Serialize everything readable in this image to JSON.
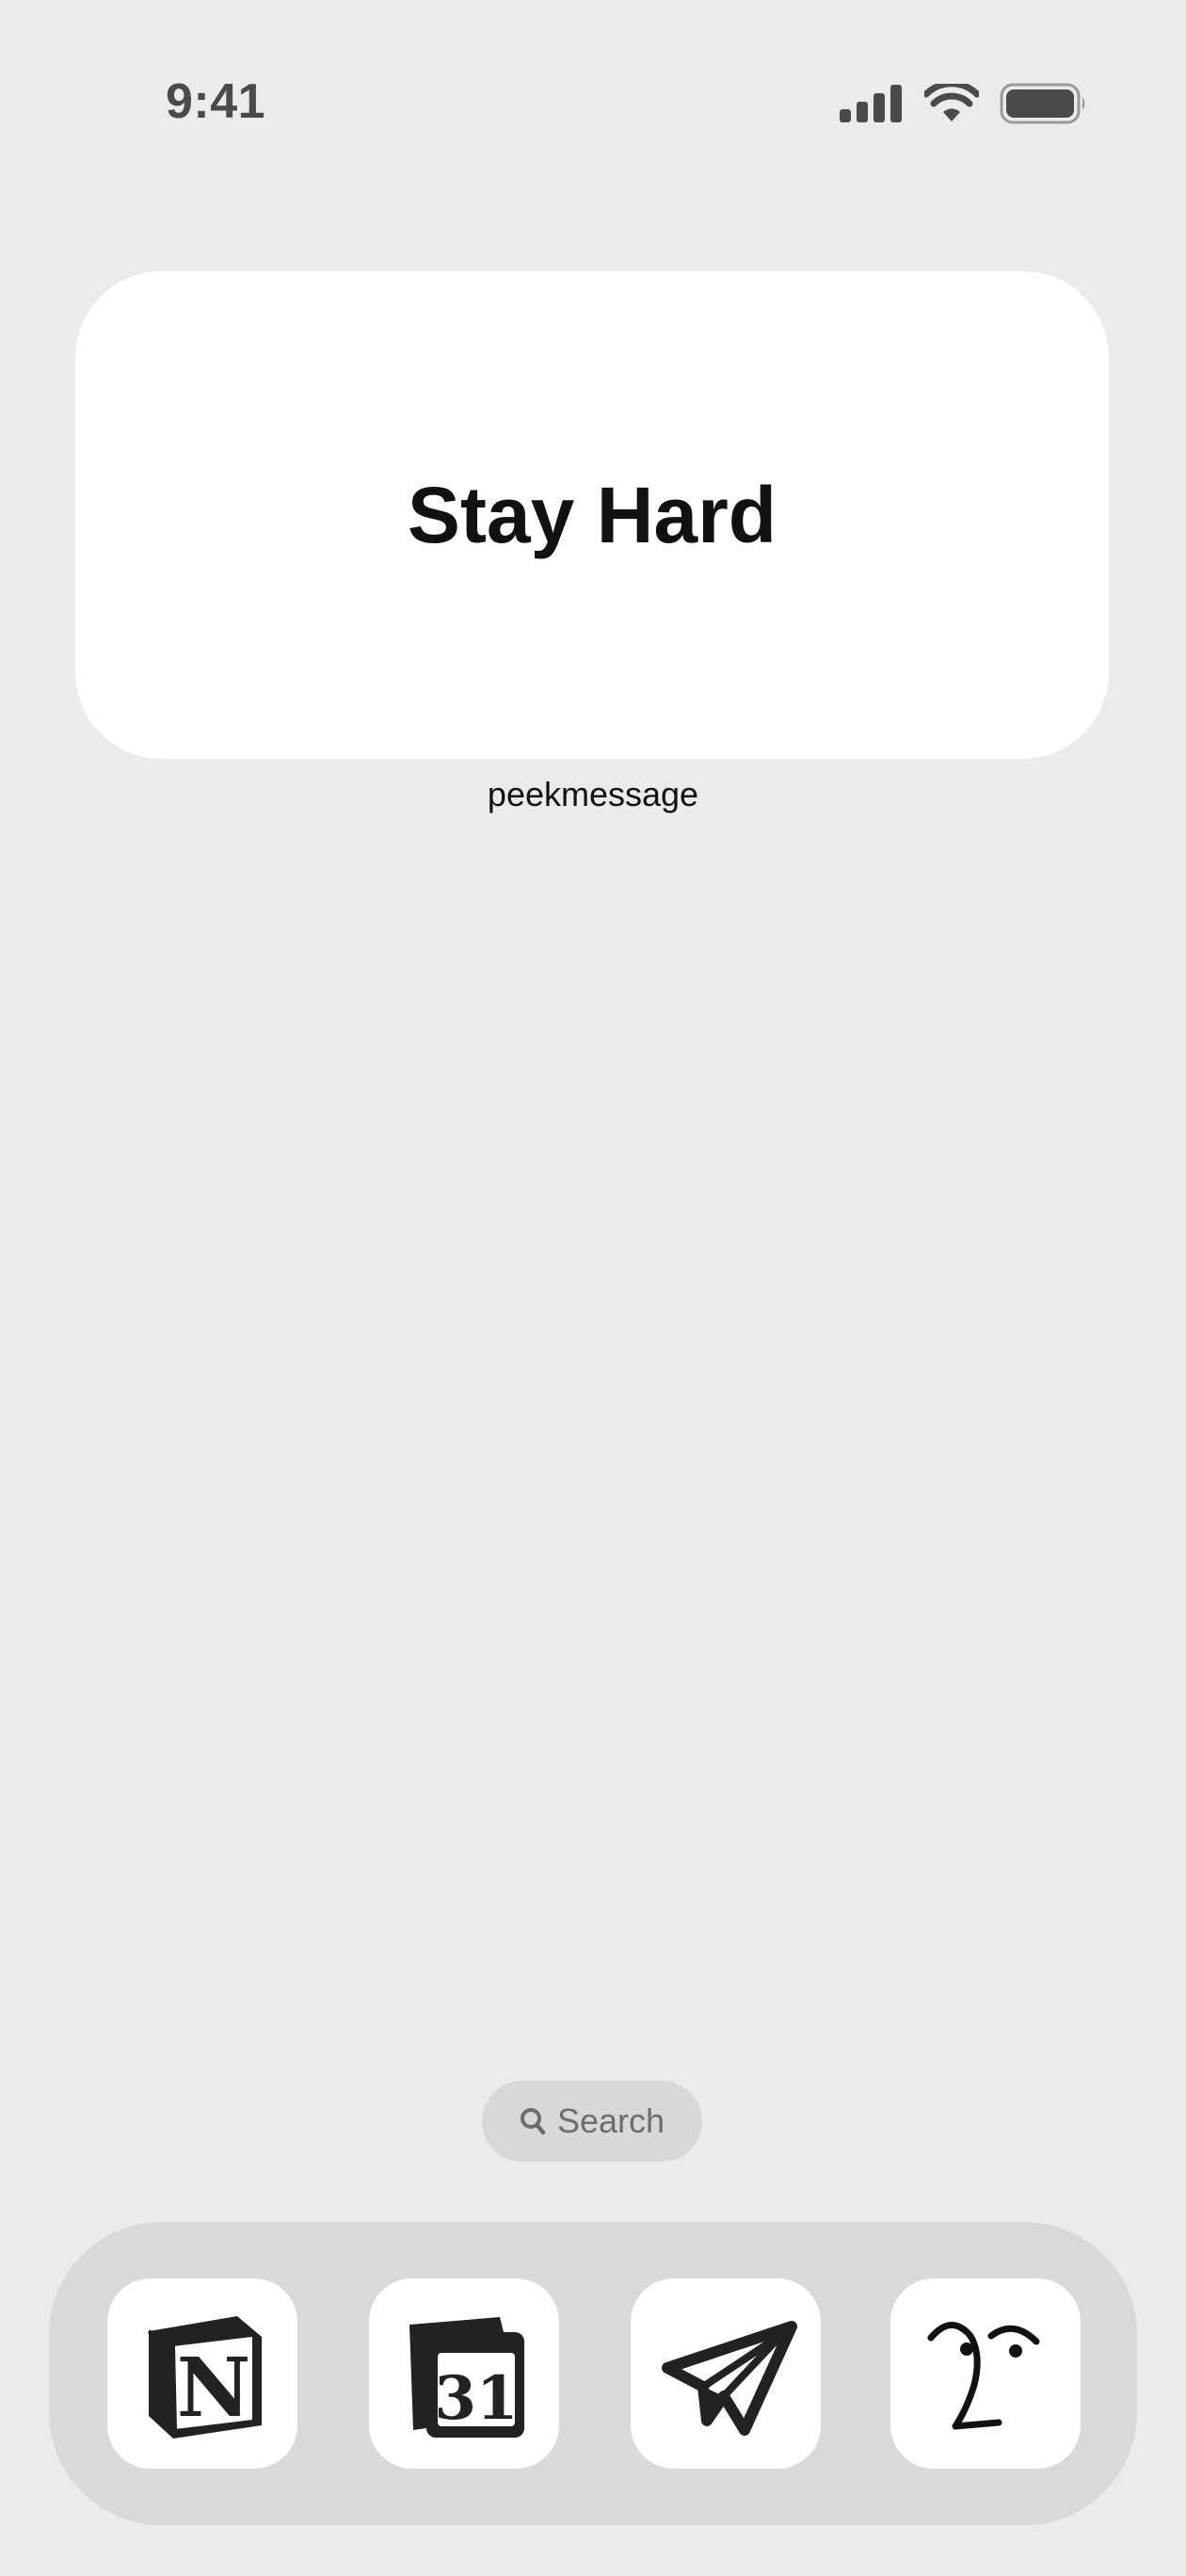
{
  "status_bar": {
    "time": "9:41",
    "icons": [
      "cellular-signal-icon",
      "wifi-icon",
      "battery-icon"
    ]
  },
  "widget": {
    "message": "Stay Hard",
    "label": "peekmessage"
  },
  "search": {
    "label": "Search",
    "icon": "search-icon"
  },
  "dock": {
    "apps": [
      {
        "icon": "notion-icon"
      },
      {
        "icon": "notion-calendar-icon",
        "text": "31"
      },
      {
        "icon": "paper-plane-icon"
      },
      {
        "icon": "face-doodle-icon"
      }
    ]
  },
  "colors": {
    "background": "#ebebeb",
    "widget": "#ffffff",
    "dock": "#d9d9d9",
    "search_pill": "#d8d8d8",
    "icon_dark": "#222222"
  }
}
